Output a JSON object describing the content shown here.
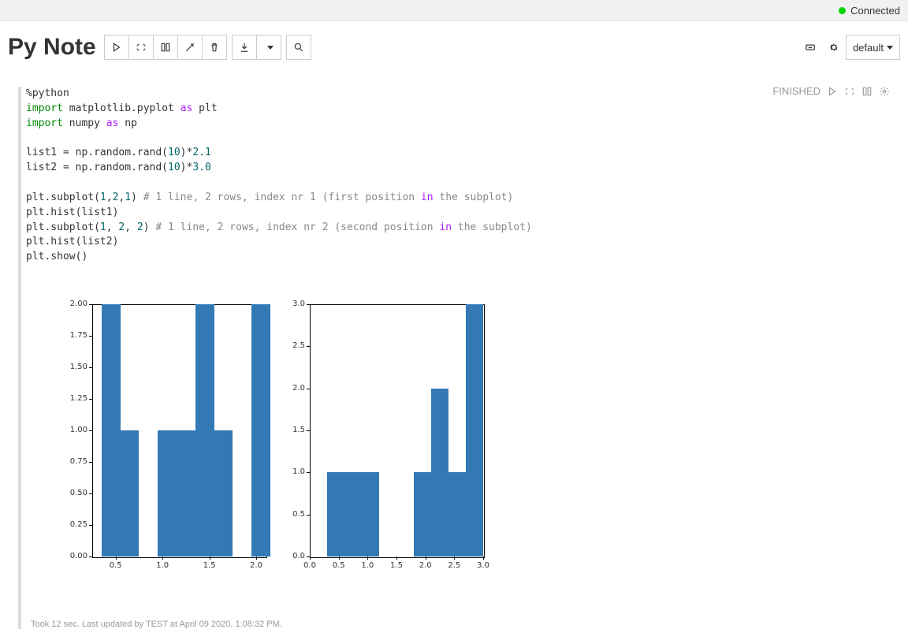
{
  "connection": {
    "status_label": "Connected"
  },
  "notebook": {
    "title": "Py Note",
    "interpreter_menu": "default"
  },
  "cell": {
    "status": "FINISHED",
    "footer": "Took 12 sec. Last updated by TEST at April 09 2020, 1:08:32 PM.",
    "code": {
      "l1": "%python",
      "l2_a": "import",
      "l2_b": " matplotlib.pyplot ",
      "l2_c": "as",
      "l2_d": " plt",
      "l3_a": "import",
      "l3_b": " numpy ",
      "l3_c": "as",
      "l3_d": " np",
      "l4_a": "list1 = np.random.rand(",
      "l4_b": "10",
      "l4_c": ")*",
      "l4_d": "2.1",
      "l5_a": "list2 = np.random.rand(",
      "l5_b": "10",
      "l5_c": ")*",
      "l5_d": "3.0",
      "l6_a": "plt.subplot(",
      "l6_b": "1",
      "l6_c": ",",
      "l6_d": "2",
      "l6_e": ",",
      "l6_f": "1",
      "l6_g": ") ",
      "l6_com": "# 1 line, 2 rows, index nr 1 (first position ",
      "l6_in": "in",
      "l6_com2": " the subplot)",
      "l7": "plt.hist(list1)",
      "l8_a": "plt.subplot(",
      "l8_b": "1",
      "l8_c": ", ",
      "l8_d": "2",
      "l8_e": ", ",
      "l8_f": "2",
      "l8_g": ") ",
      "l8_com": "# 1 line, 2 rows, index nr 2 (second position ",
      "l8_in": "in",
      "l8_com2": " the subplot)",
      "l9": "plt.hist(list2)",
      "l10": "plt.show()"
    }
  },
  "chart_data": [
    {
      "type": "bar",
      "subplot": "(1,2,1)",
      "description": "histogram of list1 (10 samples ~Uniform(0,2.1))",
      "x_centers": [
        0.45,
        0.65,
        0.85,
        1.05,
        1.25,
        1.45,
        1.65,
        1.85,
        2.05
      ],
      "values": [
        2,
        1,
        0,
        1,
        1,
        2,
        1,
        0,
        2
      ],
      "bin_width": 0.2,
      "xlim": [
        0.25,
        2.1
      ],
      "ylim": [
        0.0,
        2.0
      ],
      "yticks": [
        "0.00",
        "0.25",
        "0.50",
        "0.75",
        "1.00",
        "1.25",
        "1.50",
        "1.75",
        "2.00"
      ],
      "xticks": [
        "0.5",
        "1.0",
        "1.5",
        "2.0"
      ]
    },
    {
      "type": "bar",
      "subplot": "(1,2,2)",
      "description": "histogram of list2 (10 samples ~Uniform(0,3.0))",
      "x_centers": [
        0.15,
        0.45,
        0.75,
        1.05,
        1.35,
        1.65,
        1.95,
        2.25,
        2.55,
        2.85
      ],
      "values": [
        0,
        1,
        1,
        1,
        0,
        0,
        1,
        2,
        1,
        3
      ],
      "bin_width": 0.3,
      "xlim": [
        0.0,
        3.0
      ],
      "ylim": [
        0.0,
        3.0
      ],
      "yticks": [
        "0.0",
        "0.5",
        "1.0",
        "1.5",
        "2.0",
        "2.5",
        "3.0"
      ],
      "xticks": [
        "0.0",
        "0.5",
        "1.0",
        "1.5",
        "2.0",
        "2.5",
        "3.0"
      ]
    }
  ]
}
